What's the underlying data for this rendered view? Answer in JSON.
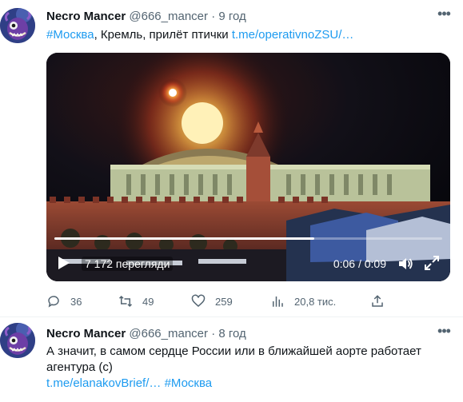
{
  "tweets": [
    {
      "author_name": "Necro Mancer",
      "handle": "@666_mancer",
      "separator": "·",
      "time": "9 год",
      "text_hashtag": "#Москва",
      "text_body": ", Кремль, прилёт птички ",
      "text_link": "t.me/operativnoZSU/…",
      "video": {
        "views": "7 172 перегляди",
        "time_current": "0:06",
        "time_sep": " / ",
        "time_total": "0:09",
        "progress_fraction": 0.67
      },
      "actions": {
        "replies": "36",
        "retweets": "49",
        "likes": "259",
        "analytics": "20,8 тис."
      }
    },
    {
      "author_name": "Necro Mancer",
      "handle": "@666_mancer",
      "separator": "·",
      "time": "8 год",
      "text_line": "А значит, в самом сердце России или в ближайшей аорте работает агентура (с)",
      "link_1": "t.me/elanakovBrief/…",
      "link_2": "#Москва"
    }
  ],
  "colors": {
    "link": "#1d9bf0",
    "secondary_text": "#536471",
    "primary_text": "#0f1419",
    "divider": "#eff3f4"
  },
  "icons": [
    "avatar",
    "more-icon",
    "play-icon",
    "volume-icon",
    "expand-icon",
    "reply-icon",
    "retweet-icon",
    "like-icon",
    "analytics-icon",
    "share-icon"
  ]
}
